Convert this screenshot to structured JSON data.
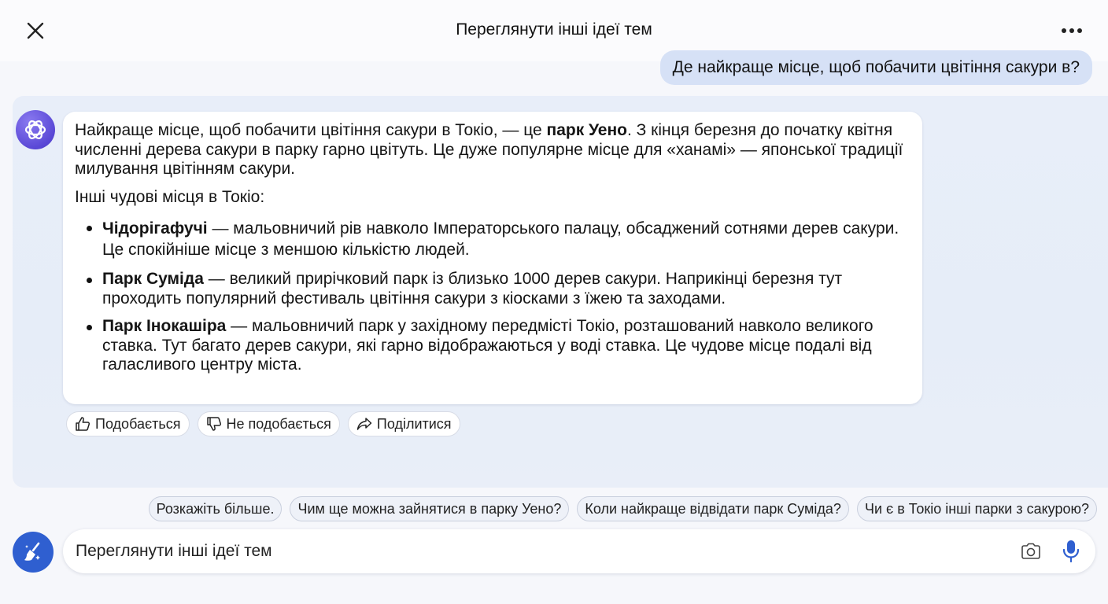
{
  "header": {
    "title": "Переглянути інші ідеї тем",
    "close_icon": "close-icon",
    "more_icon": "more-horizontal-icon"
  },
  "user_message": "Де найкраще місце, щоб побачити цвітіння сакури в?",
  "answer": {
    "avatar_icon": "openai-logo-icon",
    "intro_before": "Найкраще місце, щоб побачити цвітіння сакури в Токіо, — це ",
    "intro_bold": "парк Уено",
    "intro_after": ". З кінця березня до початку квітня численні дерева сакури в парку гарно цвітуть. Це дуже популярне місце для «ханамі» — японської традиції милування цвітінням сакури.",
    "lead": "Інші чудові місця в Токіо:",
    "items": [
      {
        "title": "Чідорігафучі",
        "text": " — мальовничий рів навколо Імператорського палацу, обсаджений сотнями дерев сакури. Це спокійніше місце з меншою кількістю людей."
      },
      {
        "title": "Парк Суміда",
        "text": " — великий прирічковий парк із близько 1000 дерев сакури. Наприкінці березня тут проходить популярний фестиваль цвітіння сакури з кіосками з їжею та заходами."
      },
      {
        "title": "Парк Інокашіра",
        "text": " — мальовничий парк у західному передмісті Токіо, розташований навколо великого ставка. Тут багато дерев сакури, які гарно відображаються у воді ставка. Це чудове місце подалі від галасливого центру міста."
      }
    ]
  },
  "actions": {
    "like": "Подобається",
    "dislike": "Не подобається",
    "share": "Поділитися"
  },
  "suggestions": [
    "Розкажіть більше.",
    "Чим ще можна зайнятися в парку Уено?",
    "Коли найкраще відвідати парк Суміда?",
    "Чи є в Токіо інші парки з сакурою?"
  ],
  "composer": {
    "placeholder": "Переглянути інші ідеї тем",
    "new_topic_icon": "broom-icon",
    "camera_icon": "camera-icon",
    "mic_icon": "microphone-icon"
  },
  "colors": {
    "accent": "#2f5fd0",
    "user_bubble": "#d6e1f6",
    "panel": "#e8eef9",
    "avatar": "#5a48d6"
  }
}
